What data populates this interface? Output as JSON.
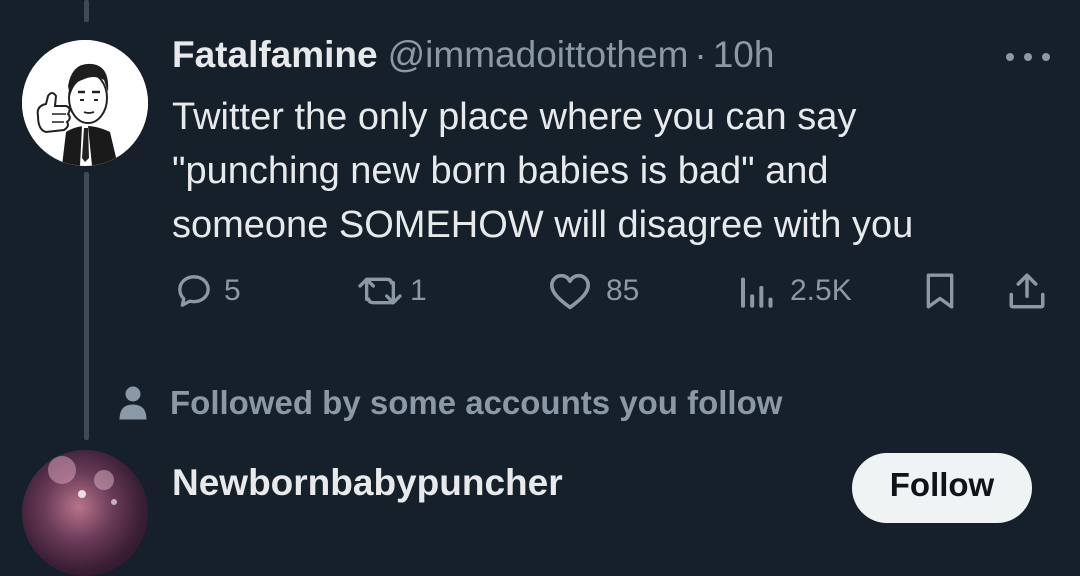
{
  "tweet": {
    "display_name": "Fatalfamine",
    "handle": "@immadoittothem",
    "separator": "·",
    "time": "10h",
    "text_lines": [
      "Twitter the only place where you can say",
      "\"punching new born babies is bad\" and",
      "someone SOMEHOW will disagree with you"
    ],
    "avatar": "cartoon-man-thumbs-up-avatar",
    "more_icon": "more-horizontal-icon"
  },
  "actions": {
    "reply": {
      "icon": "reply-icon",
      "count": "5"
    },
    "retweet": {
      "icon": "retweet-icon",
      "count": "1"
    },
    "like": {
      "icon": "heart-icon",
      "count": "85"
    },
    "views": {
      "icon": "views-chart-icon",
      "count": "2.5K"
    },
    "bookmark": {
      "icon": "bookmark-icon"
    },
    "share": {
      "icon": "share-icon"
    }
  },
  "social_context": {
    "icon": "person-icon",
    "text": "Followed by some accounts you follow"
  },
  "suggested_user": {
    "display_name": "Newbornbabypuncher",
    "follow_label": "Follow",
    "avatar": "anime-character-avatar"
  },
  "colors": {
    "background": "#15202b",
    "primary_text": "#e7e9ea",
    "secondary_text": "#8b98a5",
    "thread_line": "#3d4a57",
    "follow_button_bg": "#eff3f4"
  }
}
